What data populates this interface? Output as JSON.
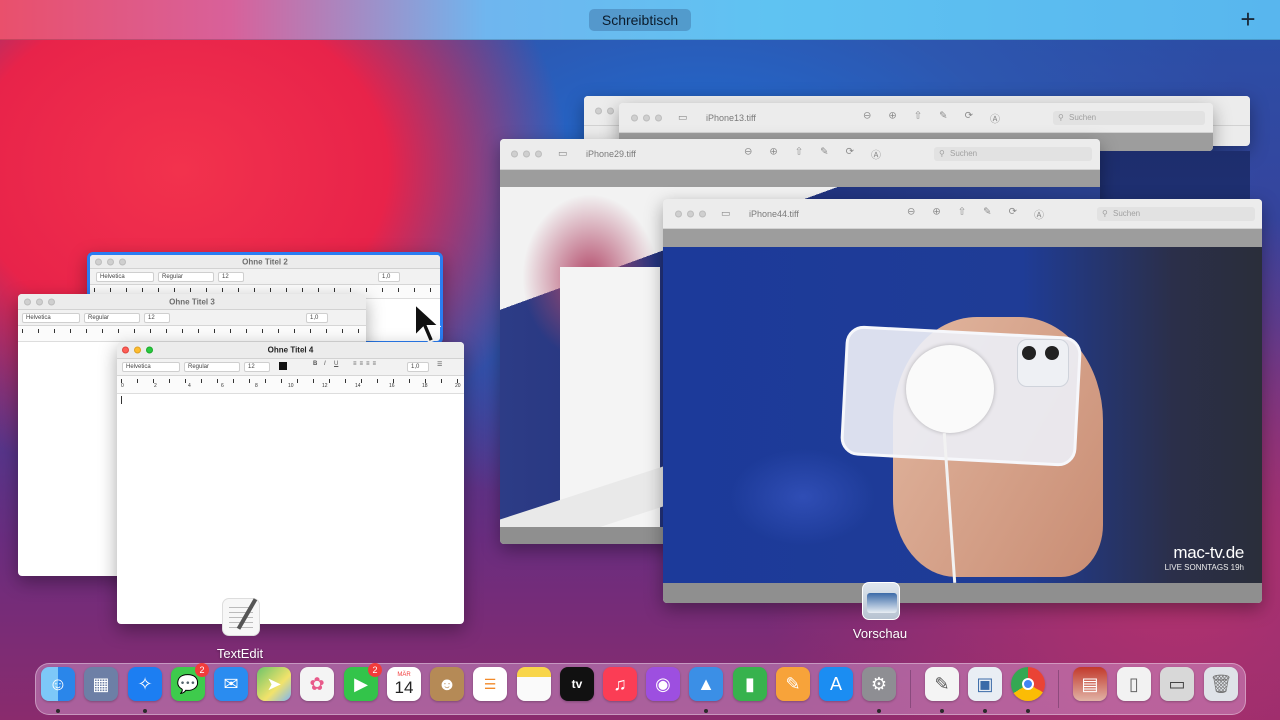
{
  "mission_control": {
    "space_label": "Schreibtisch",
    "add_space_symbol": "+"
  },
  "preview_windows": {
    "w1": {
      "title": "iPhone13.tiff",
      "search_placeholder": "Suchen"
    },
    "w2": {
      "title": "iPhone29.tiff",
      "search_placeholder": "Suchen"
    },
    "w3": {
      "title": "iPhone44.tiff",
      "search_placeholder": "Suchen"
    },
    "watermark": {
      "brand": "mac-tv.de",
      "tagline": "LIVE SONNTAGS 19h"
    }
  },
  "textedit_windows": {
    "w2": {
      "title": "Ohne Titel 2",
      "font": "Helvetica",
      "style": "Regular",
      "size": "12",
      "spacing": "1,0"
    },
    "w3": {
      "title": "Ohne Titel 3",
      "font": "Helvetica",
      "style": "Regular",
      "size": "12",
      "spacing": "1,0"
    },
    "w4": {
      "title": "Ohne Titel 4",
      "font": "Helvetica",
      "style": "Regular",
      "size": "12",
      "spacing": "1,0"
    },
    "ruler_numbers": [
      "0",
      "2",
      "4",
      "6",
      "8",
      "10",
      "12",
      "14",
      "16",
      "18",
      "20"
    ]
  },
  "app_labels": {
    "textedit": "TextEdit",
    "preview": "Vorschau"
  },
  "dock": {
    "items": [
      {
        "name": "Finder",
        "icon": "finder-icon",
        "color": "#2f8bea"
      },
      {
        "name": "Launchpad",
        "icon": "launchpad-icon",
        "color": "#6d7fa6"
      },
      {
        "name": "Safari",
        "icon": "safari-icon",
        "color": "#1c7ef2"
      },
      {
        "name": "Nachrichten",
        "icon": "messages-icon",
        "color": "#3ecb4c",
        "badge": "2"
      },
      {
        "name": "Mail",
        "icon": "mail-icon",
        "color": "#2a8cf0"
      },
      {
        "name": "Karten",
        "icon": "maps-icon",
        "color": "#6cc36a"
      },
      {
        "name": "Fotos",
        "icon": "photos-icon",
        "color": "#f4f4f4"
      },
      {
        "name": "FaceTime",
        "icon": "facetime-icon",
        "color": "#33c44a",
        "badge": "2"
      },
      {
        "name": "Kalender",
        "icon": "calendar-icon",
        "color": "#ffffff",
        "month": "MÄR",
        "day": "14"
      },
      {
        "name": "Kontakte",
        "icon": "contacts-icon",
        "color": "#b58a56"
      },
      {
        "name": "Erinnerungen",
        "icon": "reminders-icon",
        "color": "#ffffff"
      },
      {
        "name": "Notizen",
        "icon": "notes-icon",
        "color": "#f8d54a"
      },
      {
        "name": "TV",
        "icon": "tv-icon",
        "color": "#111111",
        "label": "tv"
      },
      {
        "name": "Musik",
        "icon": "music-icon",
        "color": "#fb3d55"
      },
      {
        "name": "Podcasts",
        "icon": "podcasts-icon",
        "color": "#9d4fe0"
      },
      {
        "name": "Keynote",
        "icon": "keynote-icon",
        "color": "#3b8fe6"
      },
      {
        "name": "Numbers",
        "icon": "numbers-icon",
        "color": "#37b24d"
      },
      {
        "name": "Pages",
        "icon": "pages-icon",
        "color": "#f7a33a"
      },
      {
        "name": "App Store",
        "icon": "appstore-icon",
        "color": "#1b8df2"
      },
      {
        "name": "Systemeinstellungen",
        "icon": "settings-icon",
        "color": "#8e8e93"
      },
      {
        "name": "TextEdit",
        "icon": "textedit-icon",
        "color": "#f4f4f4"
      },
      {
        "name": "Vorschau",
        "icon": "preview-icon",
        "color": "#e9eef4"
      },
      {
        "name": "Chrome",
        "icon": "chrome-icon",
        "color": "#ffffff"
      },
      {
        "name": "Photo Booth",
        "icon": "photobooth-icon",
        "color": "#c2392b"
      },
      {
        "name": "Dokument",
        "icon": "document-icon",
        "color": "#f2f2f2"
      },
      {
        "name": "Drucker",
        "icon": "printer-icon",
        "color": "#d8d8d8"
      },
      {
        "name": "Papierkorb",
        "icon": "trash-icon",
        "color": "#dfe3e8"
      }
    ]
  }
}
